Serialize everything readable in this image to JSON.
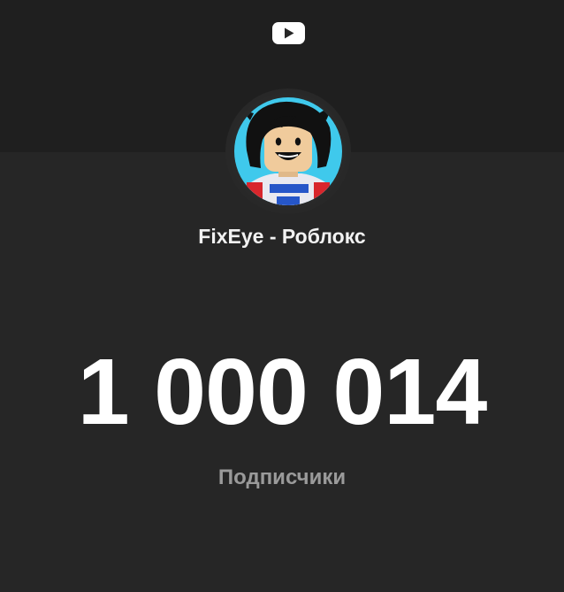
{
  "header": {
    "logo_icon": "youtube-icon"
  },
  "channel": {
    "avatar_icon": "roblox-avatar-icon",
    "name": "FixEye - Роблокс"
  },
  "stats": {
    "subscriber_count": "1 000 014",
    "subscriber_label": "Подписчики"
  },
  "colors": {
    "background": "#262626",
    "top_band": "#1f1f1f",
    "text_primary": "#ffffff",
    "text_secondary": "#9a9a9a",
    "avatar_bg": "#3fc9ec"
  }
}
